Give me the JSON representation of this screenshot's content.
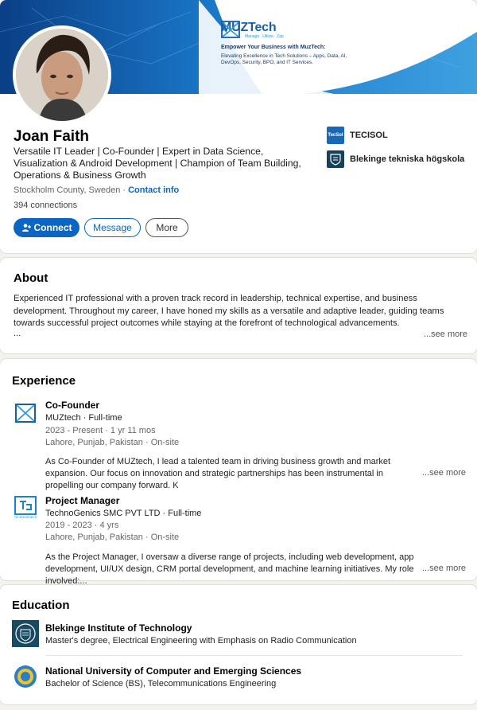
{
  "banner": {
    "brand_name": "MUZTech",
    "brand_tagline": "Manage . Utilize . Zap",
    "headline": "Empower Your Business with MuzTech:",
    "copy": "Elevating Excellence in Tech Solutions – Apps, Data, AI, DevOps, Security, BPO, and IT Services."
  },
  "profile": {
    "name": "Joan Faith",
    "headline": "Versatile IT Leader | Co-Founder | Expert in Data Science, Visualization & Android Development | Champion of Team Building, Operations & Business Growth",
    "location": "Stockholm County, Sweden · ",
    "contact_label": "Contact info",
    "connections": "394 connections",
    "buttons": {
      "connect": "Connect",
      "message": "Message",
      "more": "More"
    },
    "companies": [
      {
        "logo_text": "TecSol",
        "label": "TECISOL"
      },
      {
        "logo_text": "",
        "label": "Blekinge tekniska högskola"
      }
    ]
  },
  "about": {
    "title": "About",
    "text": "Experienced IT professional with a proven track record in leadership, technical expertise, and business development. Throughout my career, I have honed my skills as a versatile and adaptive leader, guiding teams towards successful project outcomes while staying at the forefront of technological advancements.",
    "ellipsis": "...",
    "see_more": "...see more"
  },
  "experience": {
    "title": "Experience",
    "items": [
      {
        "title": "Co-Founder",
        "company": "MUZtech · Full-time",
        "dates": "2023 - Present · 1 yr 11 mos",
        "location": "Lahore, Punjab, Pakistan · On-site",
        "description": "As Co-Founder of MUZtech, I lead a talented team in driving business growth and market expansion. Our focus on innovation and strategic partnerships has been instrumental in propelling our company forward. K",
        "see_more": "...see more"
      },
      {
        "title": "Project Manager",
        "company": "TechnoGenics SMC PVT LTD · Full-time",
        "dates": "2019 - 2023 · 4 yrs",
        "location": "Lahore, Punjab, Pakistan · On-site",
        "description": "As the Project Manager, I oversaw a diverse range of projects, including web development, app development, UI/UX design, CRM portal development, and machine learning initiatives. My role involved:...",
        "see_more": "...see more",
        "logo_caption": "TECHNOGENICS"
      }
    ]
  },
  "education": {
    "title": "Education",
    "items": [
      {
        "school": "Blekinge Institute of Technology",
        "degree": "Master's degree, Electrical Engineering with Emphasis on Radio Communication"
      },
      {
        "school": "National University of Computer and Emerging Sciences",
        "degree": "Bachelor of Science (BS), Telecommunications Engineering"
      }
    ]
  },
  "colors": {
    "accent": "#0a66c2",
    "banner_blue": "#1565c0"
  }
}
